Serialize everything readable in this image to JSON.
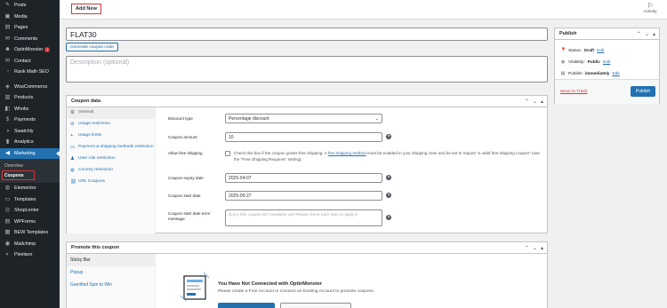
{
  "sidebar": {
    "items": [
      {
        "label": "Posts",
        "icon": "pin-icon"
      },
      {
        "label": "Media",
        "icon": "media-icon"
      },
      {
        "label": "Pages",
        "icon": "page-icon"
      },
      {
        "label": "Comments",
        "icon": "comment-icon"
      },
      {
        "label": "OptinMonster",
        "icon": "optinmonster-icon",
        "badge": "1"
      },
      {
        "label": "Contact",
        "icon": "mail-icon"
      },
      {
        "label": "Rank Math SEO",
        "icon": "chart-icon"
      },
      {
        "label": "WooCommerce",
        "icon": "woo-icon"
      },
      {
        "label": "Products",
        "icon": "box-icon"
      },
      {
        "label": "Wholis",
        "icon": "wholis-icon"
      },
      {
        "label": "Payments",
        "icon": "payments-icon"
      },
      {
        "label": "Swatchly",
        "icon": "swatch-icon"
      },
      {
        "label": "Analytics",
        "icon": "analytics-icon"
      },
      {
        "label": "Marketing",
        "icon": "megaphone-icon"
      }
    ],
    "submenu": [
      "Overview",
      "Coupons"
    ],
    "items_after": [
      {
        "label": "Elementor",
        "icon": "elementor-icon"
      },
      {
        "label": "Templates",
        "icon": "folder-icon"
      },
      {
        "label": "ShopLentor",
        "icon": "shoplentor-icon"
      },
      {
        "label": "WPForms",
        "icon": "form-icon"
      },
      {
        "label": "BEW Templates",
        "icon": "layout-icon"
      },
      {
        "label": "Mailchimp",
        "icon": "mailchimp-icon"
      },
      {
        "label": "Pixelavo",
        "icon": "pixel-icon"
      }
    ]
  },
  "topbar": {
    "add_new": "Add New",
    "activity": "Activity"
  },
  "coupon": {
    "title": "FLAT30",
    "generate_label": "Generate coupon code",
    "description_placeholder": "Description (optional)"
  },
  "coupon_data": {
    "heading": "Coupon data",
    "tabs": [
      {
        "label": "General",
        "icon": "gear-icon"
      },
      {
        "label": "Usage restriction",
        "icon": "ban-icon"
      },
      {
        "label": "Usage limits",
        "icon": "plus-icon"
      },
      {
        "label": "Payment & shipping methods restriction",
        "icon": "truck-icon"
      },
      {
        "label": "User role restriction",
        "icon": "user-icon"
      },
      {
        "label": "Country restriction",
        "icon": "globe-icon"
      },
      {
        "label": "URL Coupons",
        "icon": "link-icon"
      }
    ],
    "fields": {
      "discount_type_label": "Discount type",
      "discount_type_value": "Percentage discount",
      "amount_label": "Coupon amount",
      "amount_value": "10",
      "free_shipping_label": "Allow free shipping",
      "free_shipping_text_1": "Check this box if the coupon grants free shipping. A",
      "free_shipping_link": "free shipping method",
      "free_shipping_text_2": "must be enabled in your shipping zone and be set to require \"a valid free shipping coupon\" (see the \"Free Shipping Requires\" setting).",
      "expiry_label": "Coupon expiry date",
      "expiry_value": "2025-04-07",
      "start_label": "Coupon start date",
      "start_value": "2025-05-27",
      "error_label": "Coupon start date error message",
      "error_placeholder": "Sorry, this coupon isn't available yet! Please check back later to apply it."
    }
  },
  "promote": {
    "heading": "Promote this coupon",
    "tabs": [
      "Sticky Bar",
      "Popup",
      "Gamified Spin to Win"
    ],
    "title": "You Have Not Connected with OptinMonster",
    "desc": "Please create a Free Account or Connect an Existing Account to promote coupons."
  },
  "publish": {
    "heading": "Publish",
    "status_label": "Status:",
    "status_value": "Draft",
    "visibility_label": "Visibility:",
    "visibility_value": "Public",
    "publish_label": "Publish",
    "publish_value": "immediately",
    "edit": "Edit",
    "trash": "Move to Trash",
    "button": "Publish"
  },
  "colors": {
    "sidebar": "#1d2327",
    "accent": "#2271b1",
    "highlight": "#d63638"
  }
}
